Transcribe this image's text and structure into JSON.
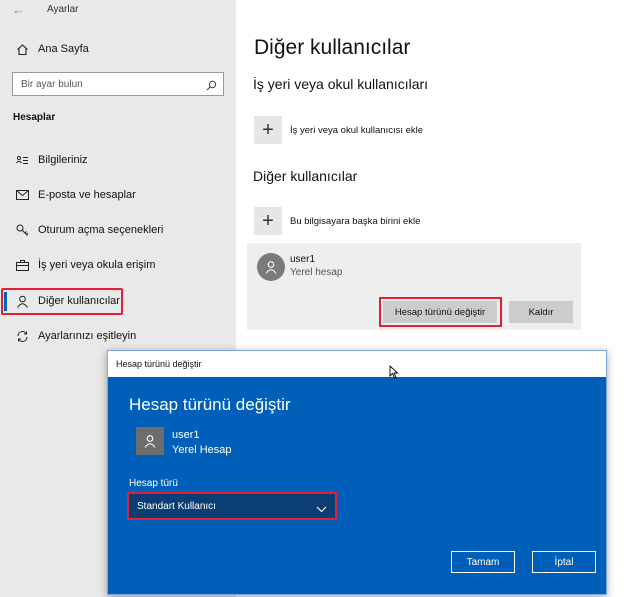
{
  "window": {
    "back_glyph": "←",
    "title": "Ayarlar"
  },
  "sidebar": {
    "home_label": "Ana Sayfa",
    "search_placeholder": "Bir ayar bulun",
    "section_title": "Hesaplar",
    "items": [
      {
        "label": "Bilgileriniz",
        "icon": "person-card-icon"
      },
      {
        "label": "E-posta ve hesaplar",
        "icon": "mail-icon"
      },
      {
        "label": "Oturum açma seçenekleri",
        "icon": "key-icon"
      },
      {
        "label": "İş yeri veya okula erişim",
        "icon": "briefcase-icon"
      },
      {
        "label": "Diğer kullanıcılar",
        "icon": "person-icon"
      },
      {
        "label": "Ayarlarınızı eşitleyin",
        "icon": "sync-icon"
      }
    ],
    "selected_index": 4
  },
  "main": {
    "title": "Diğer kullanıcılar",
    "work_section_title": "İş yeri veya okul kullanıcıları",
    "add_work_label": "İş yeri veya okul kullanıcısı ekle",
    "other_section_title": "Diğer kullanıcılar",
    "add_other_label": "Bu bilgisayara başka birini ekle",
    "plus_glyph": "+",
    "user": {
      "name": "user1",
      "type": "Yerel hesap"
    },
    "change_type_button": "Hesap türünü değiştir",
    "remove_button": "Kaldır"
  },
  "dialog": {
    "window_title": "Hesap türünü değiştir",
    "heading": "Hesap türünü değiştir",
    "user": {
      "name": "user1",
      "type": "Yerel Hesap"
    },
    "account_type_label": "Hesap türü",
    "account_type_value": "Standart Kullanıcı",
    "ok_button": "Tamam",
    "cancel_button": "İptal"
  },
  "colors": {
    "accent": "#005fb8",
    "highlight": "#e0203a",
    "sidebar_bg": "#e9e9e9"
  }
}
